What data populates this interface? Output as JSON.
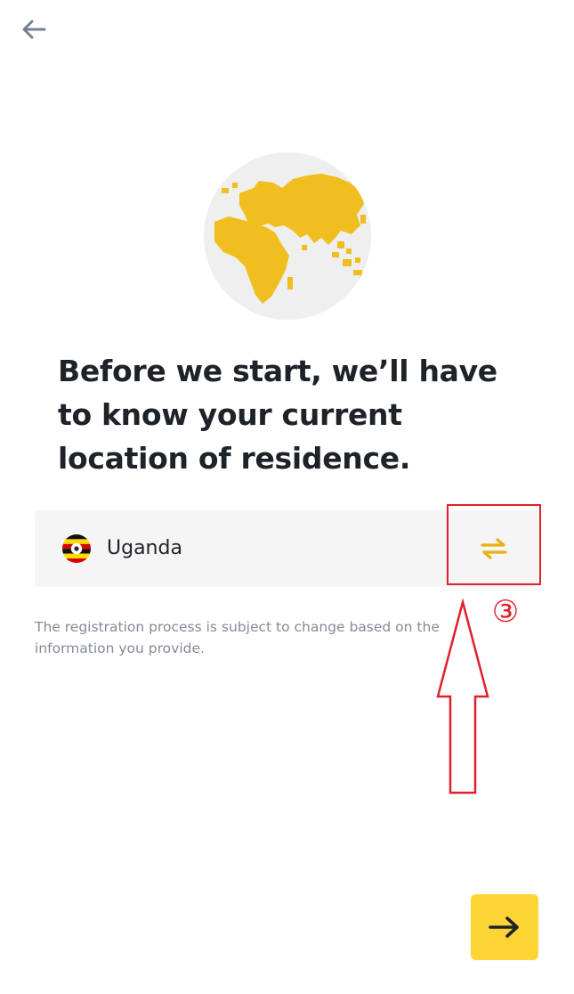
{
  "header": {
    "back_icon": "arrow-left-icon"
  },
  "illustration": {
    "icon": "globe-icon",
    "colors": {
      "land": "#f0bf1f",
      "sea": "#efefef"
    }
  },
  "heading": {
    "text": "Before we start, we’ll have to know your current location of residence."
  },
  "residence": {
    "country": "Uganda",
    "flag_icon": "uganda-flag-icon",
    "change_icon": "swap-arrows-icon"
  },
  "note": {
    "text": "The registration process is subject to change based on the information you provide."
  },
  "annotation": {
    "step": "③",
    "color": "#e0202b"
  },
  "footer": {
    "next_icon": "arrow-right-icon",
    "accent_color": "#fcd535"
  }
}
